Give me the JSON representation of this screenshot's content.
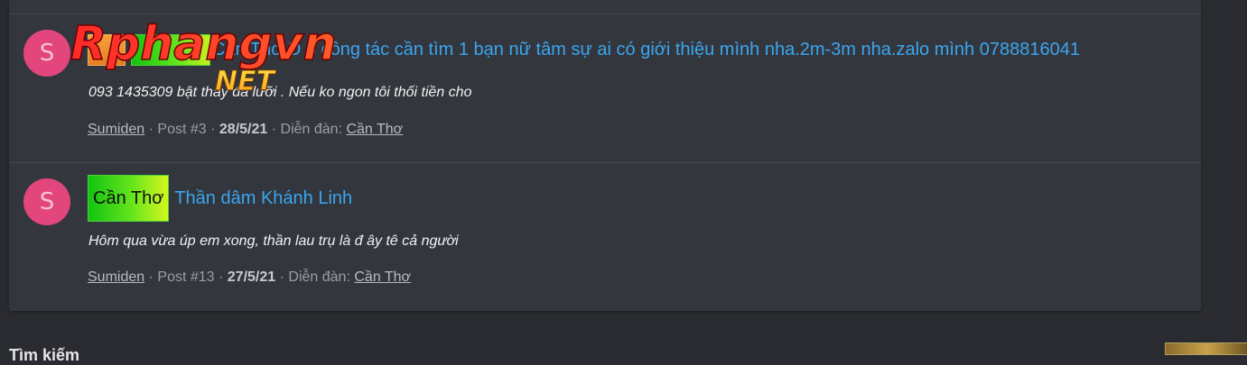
{
  "posts": [
    {
      "avatar_letter": "S",
      "title": "Cần Thơ Đ ô công tác cần tìm 1 bạn nữ tâm sự ai có giới thiệu mình nha.2m-3m nha.zalo mình 0788816041",
      "snippet": "093 1435309 bật thấy đá lưỡi . Nếu ko ngon tôi thối tiền cho",
      "author": "Sumiden",
      "post_no": "Post #3",
      "date": "28/5/21",
      "forum_label": "Diễn đàn:",
      "forum": "Cần Thơ"
    },
    {
      "avatar_letter": "S",
      "tag": "Cần Thơ",
      "title": "Thần dâm Khánh Linh",
      "snippet": "Hôm qua vừa úp em xong, thần lau trụ là đ ây tê cả người",
      "author": "Sumiden",
      "post_no": "Post #13",
      "date": "27/5/21",
      "forum_label": "Diễn đàn:",
      "forum": "Cần Thơ"
    }
  ],
  "watermark": {
    "brand": "Rphangvn",
    "suffix": "NET"
  },
  "footer": {
    "partial_heading": "Tìm kiếm"
  },
  "colors": {
    "link": "#3aa6ef",
    "avatar": "#e3467c",
    "tag_green": "#4ed33a",
    "tag_orange": "#e67e22"
  }
}
